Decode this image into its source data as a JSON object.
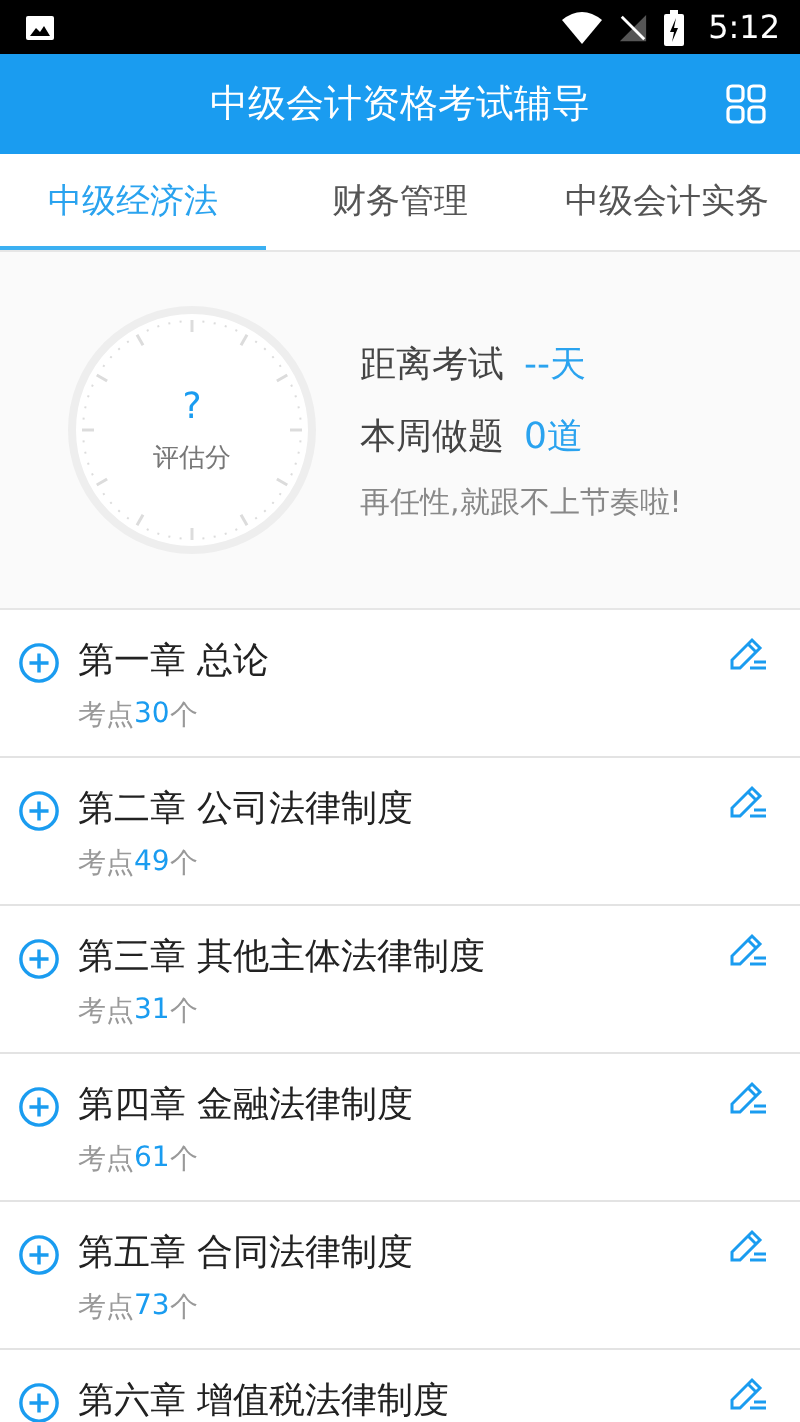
{
  "status_bar": {
    "time": "5:12"
  },
  "header": {
    "title": "中级会计资格考试辅导"
  },
  "tabs": [
    {
      "label": "中级经济法",
      "selected": true
    },
    {
      "label": "财务管理",
      "selected": false
    },
    {
      "label": "中级会计实务",
      "selected": false
    }
  ],
  "summary": {
    "score": "?",
    "score_label": "评估分",
    "exam_label": "距离考试",
    "exam_value": "--天",
    "practice_label": "本周做题",
    "practice_value": "0道",
    "slogan": "再任性,就跟不上节奏啦!"
  },
  "chapters": [
    {
      "title": "第一章 总论",
      "points_prefix": "考点",
      "points": "30",
      "points_suffix": "个"
    },
    {
      "title": "第二章 公司法律制度",
      "points_prefix": "考点",
      "points": "49",
      "points_suffix": "个"
    },
    {
      "title": "第三章 其他主体法律制度",
      "points_prefix": "考点",
      "points": "31",
      "points_suffix": "个"
    },
    {
      "title": "第四章 金融法律制度",
      "points_prefix": "考点",
      "points": "61",
      "points_suffix": "个"
    },
    {
      "title": "第五章 合同法律制度",
      "points_prefix": "考点",
      "points": "73",
      "points_suffix": "个"
    },
    {
      "title": "第六章 增值税法律制度"
    }
  ]
}
